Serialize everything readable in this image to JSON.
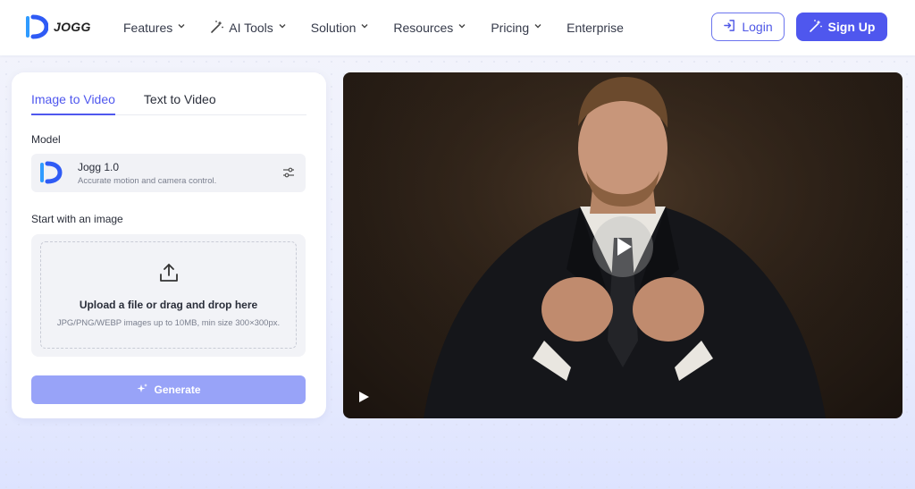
{
  "header": {
    "brand": "JOGG",
    "nav": [
      {
        "label": "Features",
        "has_dropdown": true,
        "icon": "chevron-down-icon"
      },
      {
        "label": "AI Tools",
        "has_dropdown": true,
        "leading_icon": "magic-wand-icon",
        "icon": "chevron-down-icon"
      },
      {
        "label": "Solution",
        "has_dropdown": true,
        "icon": "chevron-down-icon"
      },
      {
        "label": "Resources",
        "has_dropdown": true,
        "icon": "chevron-down-icon"
      },
      {
        "label": "Pricing",
        "has_dropdown": true,
        "icon": "chevron-down-icon"
      },
      {
        "label": "Enterprise",
        "has_dropdown": false
      }
    ],
    "login_label": "Login",
    "signup_label": "Sign Up"
  },
  "panel": {
    "tabs": [
      {
        "label": "Image to Video",
        "active": true
      },
      {
        "label": "Text to Video",
        "active": false
      }
    ],
    "model_label": "Model",
    "model": {
      "name": "Jogg 1.0",
      "description": "Accurate motion and camera control."
    },
    "start_label": "Start with an image",
    "upload": {
      "title": "Upload a file or drag and drop here",
      "hint": "JPG/PNG/WEBP images up to 10MB, min size 300×300px."
    },
    "generate_label": "Generate"
  },
  "colors": {
    "accent": "#4f57ee",
    "accent_disabled": "#98a3f8",
    "logo_blue": "#2f5bf5"
  }
}
